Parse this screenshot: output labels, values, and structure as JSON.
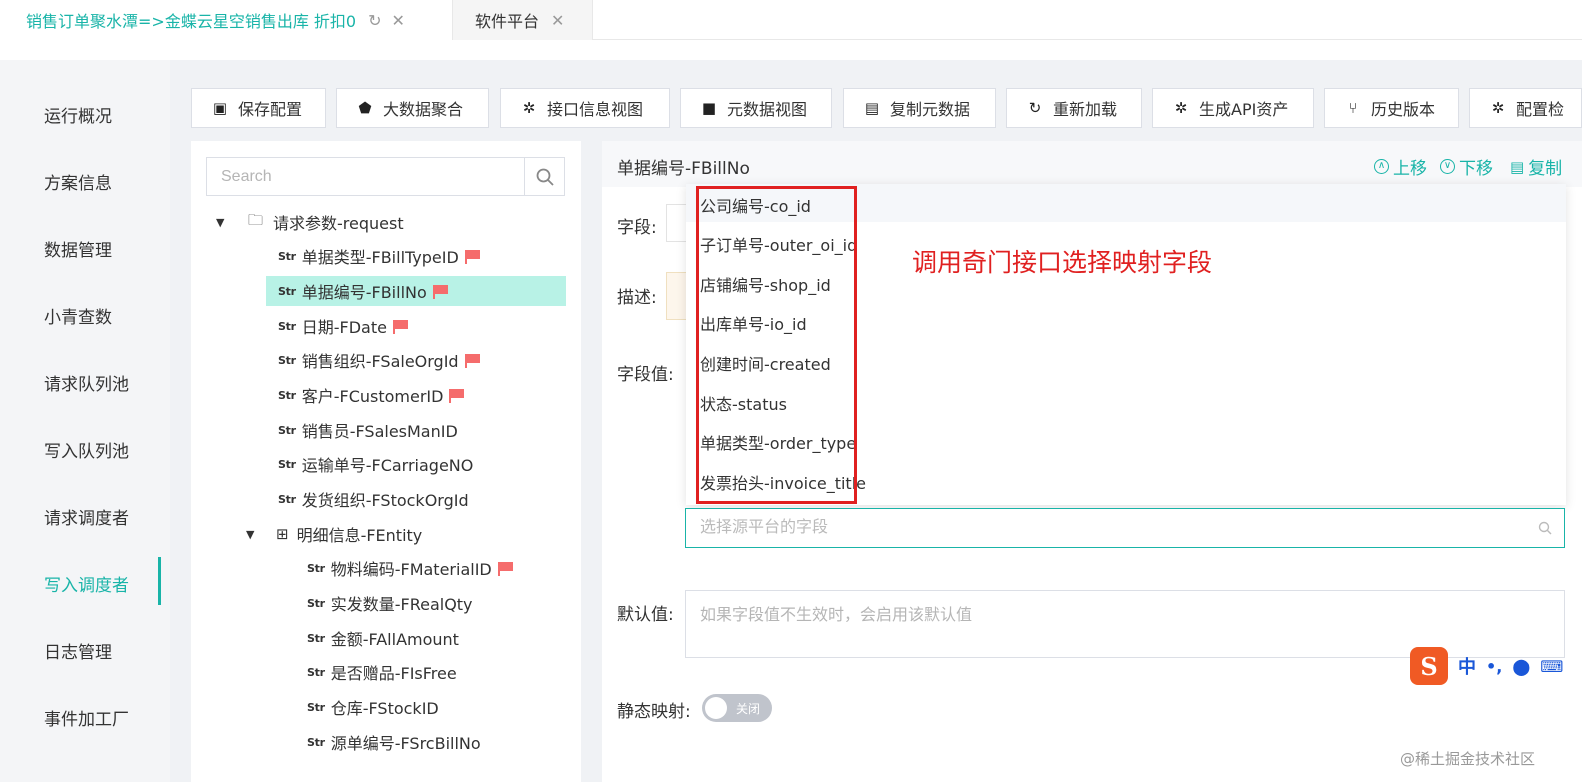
{
  "tabs": [
    {
      "label": "销售订单聚水潭=>金蝶云星空销售出库 折扣0",
      "active": true
    },
    {
      "label": "软件平台",
      "active": false
    }
  ],
  "sidebar": {
    "items": [
      "运行概况",
      "方案信息",
      "数据管理",
      "小青查数",
      "请求队列池",
      "写入队列池",
      "请求调度者",
      "写入调度者",
      "日志管理",
      "事件加工厂"
    ],
    "active_index": 7
  },
  "toolbar": {
    "buttons": [
      "保存配置",
      "大数据聚合",
      "接口信息视图",
      "元数据视图",
      "复制元数据",
      "重新加载",
      "生成API资产",
      "历史版本",
      "配置检"
    ]
  },
  "tree": {
    "search_placeholder": "Search",
    "str_tag": "Str",
    "rows": [
      {
        "label": "请求参数-request",
        "flag": false
      },
      {
        "label": "单据类型-FBillTypeID",
        "flag": true
      },
      {
        "label": "单据编号-FBillNo",
        "flag": true
      },
      {
        "label": "日期-FDate",
        "flag": true
      },
      {
        "label": "销售组织-FSaleOrgId",
        "flag": true
      },
      {
        "label": "客户-FCustomerID",
        "flag": true
      },
      {
        "label": "销售员-FSalesManID",
        "flag": false
      },
      {
        "label": "运输单号-FCarriageNO",
        "flag": false
      },
      {
        "label": "发货组织-FStockOrgId",
        "flag": false
      },
      {
        "label": "明细信息-FEntity",
        "flag": false
      },
      {
        "label": "物料编码-FMaterialID",
        "flag": true
      },
      {
        "label": "实发数量-FRealQty",
        "flag": false
      },
      {
        "label": "金额-FAllAmount",
        "flag": false
      },
      {
        "label": "是否赠品-FIsFree",
        "flag": false
      },
      {
        "label": "仓库-FStockID",
        "flag": false
      },
      {
        "label": "源单编号-FSrcBillNo",
        "flag": false
      }
    ]
  },
  "detail": {
    "title": "单据编号-FBillNo",
    "actions": {
      "up": "上移",
      "down": "下移",
      "copy": "复制"
    },
    "labels": {
      "field": "字段:",
      "desc": "描述:",
      "value": "字段值:",
      "default": "默认值:",
      "static": "静态映射:"
    },
    "dropdown_options": [
      "公司编号-co_id",
      "子订单号-outer_oi_id",
      "店铺编号-shop_id",
      "出库单号-io_id",
      "创建时间-created",
      "状态-status",
      "单据类型-order_type",
      "发票抬头-invoice_title"
    ],
    "annotation": "调用奇门接口选择映射字段",
    "select_placeholder": "选择源平台的字段",
    "default_placeholder": "如果字段值不生效时，会启用该默认值",
    "switch_label": "关闭"
  },
  "ime": {
    "mode": "中",
    "logo": "S"
  },
  "watermark": "@稀土掘金技术社区",
  "colors": {
    "accent": "#19b4a8",
    "annotation": "#e02020",
    "flag": "#f56c6c"
  }
}
